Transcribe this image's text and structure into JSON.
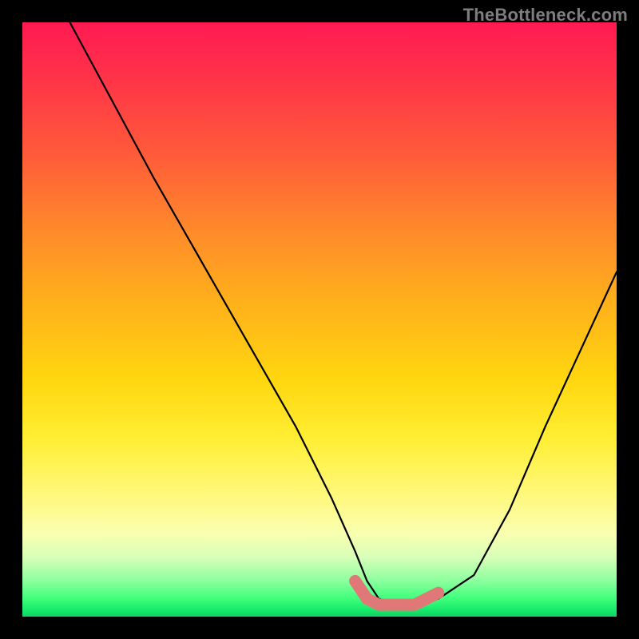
{
  "watermark": {
    "text": "TheBottleneck.com"
  },
  "chart_data": {
    "type": "line",
    "title": "",
    "xlabel": "",
    "ylabel": "",
    "xlim": [
      0,
      100
    ],
    "ylim": [
      0,
      100
    ],
    "grid": false,
    "legend": false,
    "series": [
      {
        "name": "bottleneck-curve",
        "x": [
          8,
          15,
          22,
          30,
          38,
          46,
          52,
          56,
          58,
          60,
          63,
          66,
          70,
          76,
          82,
          88,
          94,
          100
        ],
        "y": [
          100,
          87,
          74,
          60,
          46,
          32,
          20,
          11,
          6,
          3,
          2,
          2,
          3,
          7,
          18,
          32,
          45,
          58
        ]
      }
    ],
    "highlight_segment": {
      "name": "flat-bottom-marker",
      "color": "#e17878",
      "x": [
        56,
        58,
        60,
        63,
        66,
        70
      ],
      "y": [
        6,
        3,
        2,
        2,
        2,
        4
      ]
    }
  }
}
